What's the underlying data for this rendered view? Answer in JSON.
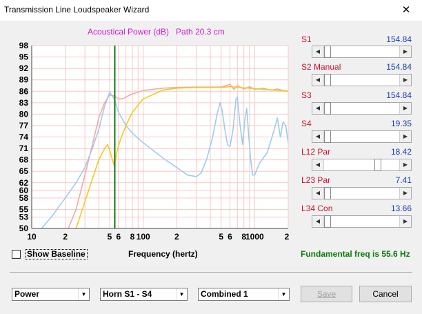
{
  "window": {
    "title": "Transmission Line Loudspeaker Wizard",
    "close_glyph": "✕"
  },
  "chart_title": "Acoustical Power (dB)   Path 20.3 cm",
  "chart_data": {
    "type": "line",
    "title": "Acoustical Power (dB)   Path 20.3 cm",
    "xlabel": "Frequency (hertz)",
    "ylabel": "",
    "x_scale": "log",
    "xlim": [
      10,
      2000
    ],
    "ylim": [
      50,
      98
    ],
    "yticks": [
      50,
      53,
      55,
      58,
      60,
      62,
      65,
      68,
      71,
      74,
      77,
      80,
      83,
      86,
      89,
      92,
      95,
      98
    ],
    "xtick_labels": [
      {
        "x": 10,
        "label": "10"
      },
      {
        "x": 20,
        "label": "2"
      },
      {
        "x": 50,
        "label": "5"
      },
      {
        "x": 60,
        "label": "6"
      },
      {
        "x": 80,
        "label": "8"
      },
      {
        "x": 100,
        "label": "100"
      },
      {
        "x": 200,
        "label": "2"
      },
      {
        "x": 500,
        "label": "5"
      },
      {
        "x": 600,
        "label": "6"
      },
      {
        "x": 800,
        "label": "8"
      },
      {
        "x": 1000,
        "label": "1000"
      },
      {
        "x": 2000,
        "label": "2"
      }
    ],
    "marker_x": 55.6,
    "grid": true,
    "colors": {
      "green_marker": "#0a7a0a",
      "grid": "#f3c9c3"
    },
    "series": [
      {
        "color": "#f4a9a3",
        "points": [
          [
            15,
            40
          ],
          [
            20,
            48
          ],
          [
            25,
            55
          ],
          [
            30,
            64
          ],
          [
            35,
            72
          ],
          [
            40,
            79
          ],
          [
            45,
            83
          ],
          [
            50,
            85
          ],
          [
            55,
            84.8
          ],
          [
            60,
            84
          ],
          [
            65,
            84
          ],
          [
            70,
            84.5
          ],
          [
            80,
            85.3
          ],
          [
            100,
            86.2
          ],
          [
            150,
            86.8
          ],
          [
            200,
            87
          ],
          [
            300,
            87.1
          ],
          [
            500,
            87.1
          ],
          [
            600,
            87.8
          ],
          [
            650,
            86.5
          ],
          [
            700,
            87.5
          ],
          [
            800,
            86.6
          ],
          [
            900,
            87.2
          ],
          [
            1000,
            86.5
          ],
          [
            1200,
            86.8
          ],
          [
            1400,
            86.3
          ],
          [
            1600,
            86.6
          ],
          [
            1800,
            86.2
          ],
          [
            2000,
            86
          ]
        ]
      },
      {
        "color": "#9ecbf0",
        "points": [
          [
            10,
            47
          ],
          [
            15,
            53
          ],
          [
            20,
            58
          ],
          [
            25,
            62
          ],
          [
            30,
            66
          ],
          [
            35,
            71
          ],
          [
            40,
            76
          ],
          [
            45,
            82
          ],
          [
            50,
            85.8
          ],
          [
            55,
            84
          ],
          [
            60,
            80.5
          ],
          [
            70,
            77
          ],
          [
            80,
            75
          ],
          [
            100,
            72.5
          ],
          [
            150,
            68.5
          ],
          [
            200,
            66
          ],
          [
            250,
            64
          ],
          [
            300,
            63.6
          ],
          [
            330,
            64.5
          ],
          [
            370,
            68
          ],
          [
            420,
            74
          ],
          [
            460,
            80
          ],
          [
            490,
            83
          ],
          [
            510,
            81
          ],
          [
            540,
            76
          ],
          [
            570,
            72
          ],
          [
            600,
            71.5
          ],
          [
            640,
            76
          ],
          [
            680,
            84
          ],
          [
            700,
            84.5
          ],
          [
            740,
            77
          ],
          [
            780,
            72
          ],
          [
            820,
            79
          ],
          [
            850,
            81.5
          ],
          [
            880,
            75
          ],
          [
            920,
            68
          ],
          [
            960,
            64
          ],
          [
            1000,
            64
          ],
          [
            1100,
            67
          ],
          [
            1300,
            70
          ],
          [
            1500,
            76
          ],
          [
            1600,
            79
          ],
          [
            1700,
            74
          ],
          [
            1800,
            78
          ],
          [
            1900,
            77
          ],
          [
            2000,
            72.5
          ]
        ]
      },
      {
        "color": "#f7c71a",
        "points": [
          [
            15,
            40
          ],
          [
            20,
            45
          ],
          [
            25,
            50
          ],
          [
            30,
            57
          ],
          [
            35,
            63
          ],
          [
            40,
            68
          ],
          [
            45,
            71
          ],
          [
            48,
            72
          ],
          [
            50,
            70.5
          ],
          [
            53,
            68
          ],
          [
            55,
            66.5
          ],
          [
            58,
            70
          ],
          [
            62,
            73
          ],
          [
            70,
            77
          ],
          [
            80,
            80.5
          ],
          [
            100,
            84
          ],
          [
            150,
            86.3
          ],
          [
            200,
            86.8
          ],
          [
            300,
            87
          ],
          [
            500,
            87
          ],
          [
            600,
            87.2
          ],
          [
            800,
            86.9
          ],
          [
            1000,
            86.7
          ],
          [
            1500,
            86.3
          ],
          [
            2000,
            86
          ]
        ]
      }
    ]
  },
  "sliders": [
    {
      "label": "S1",
      "value": "154.84",
      "thumb_fraction": 0.0
    },
    {
      "label": "S2  Manual",
      "value": "154.84",
      "thumb_fraction": 0.0
    },
    {
      "label": "S3",
      "value": "154.84",
      "thumb_fraction": 0.0
    },
    {
      "label": "S4",
      "value": "19.35",
      "thumb_fraction": 0.0
    },
    {
      "label": "L12  Par",
      "value": "18.42",
      "thumb_fraction": 0.95
    },
    {
      "label": "L23  Par",
      "value": "7.41",
      "thumb_fraction": 0.0
    },
    {
      "label": "L34  Con",
      "value": "13.66",
      "thumb_fraction": 0.0
    }
  ],
  "show_baseline": {
    "label": "Show Baseline",
    "checked": false
  },
  "x_axis_label": "Frequency (hertz)",
  "fundamental": "Fundamental freq is 55.6 Hz",
  "combos": {
    "power": "Power",
    "horn": "Horn S1 - S4",
    "combined": "Combined 1"
  },
  "buttons": {
    "save": "Save",
    "cancel": "Cancel"
  },
  "icons": {
    "arrow_left": "◀",
    "arrow_right": "▶",
    "dropdown": "▼"
  }
}
